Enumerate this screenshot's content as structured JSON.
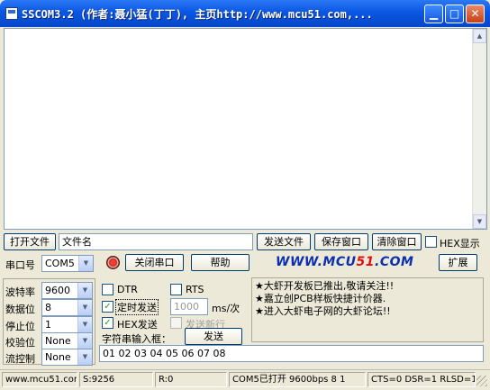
{
  "window": {
    "title": "SSCOM3.2 (作者:聂小猛(丁丁), 主页http://www.mcu51.com,..."
  },
  "toolbar1": {
    "open_file": "打开文件",
    "filename": "文件名",
    "send_file": "发送文件",
    "save_window": "保存窗口",
    "clear_window": "清除窗口",
    "hex_display": "HEX显示",
    "hex_display_checked": false
  },
  "toolbar2": {
    "port_label": "串口号",
    "port_value": "COM5",
    "close_port": "关闭串口",
    "help": "帮助",
    "brand_blue": "WWW.MCU",
    "brand_red": "51",
    "brand_tail": ".COM",
    "expand": "扩展"
  },
  "settings": {
    "baud_label": "波特率",
    "baud_value": "9600",
    "databits_label": "数据位",
    "databits_value": "8",
    "stopbits_label": "停止位",
    "stopbits_value": "1",
    "parity_label": "校验位",
    "parity_value": "None",
    "flow_label": "流控制",
    "flow_value": "None"
  },
  "options": {
    "dtr": "DTR",
    "dtr_checked": false,
    "rts": "RTS",
    "rts_checked": false,
    "timed_send": "定时发送",
    "timed_send_checked": true,
    "interval": "1000",
    "interval_unit": "ms/次",
    "hex_send": "HEX发送",
    "hex_send_checked": true,
    "send_newline": "发送新行",
    "send_newline_checked": false,
    "input_label": "字符串输入框：",
    "send_button": "发送",
    "input_value": "01 02 03 04 05 06 07 08"
  },
  "ad": {
    "lines": [
      "★大虾开发板已推出,敬请关注!!",
      "★嘉立创PCB样板快捷计价器.",
      "★进入大虾电子网的大虾论坛!!"
    ]
  },
  "status": {
    "site": "www.mcu51.com",
    "sent": "S:9256",
    "recv": "R:0",
    "port_state": "COM5已打开  9600bps  8 1",
    "lines": "CTS=0 DSR=1 RLSD=1"
  },
  "colors": {
    "title_bar": "#0a56e4",
    "brand_blue": "#0b2fb0",
    "brand_red": "#e01010",
    "face": "#ece9d8"
  }
}
